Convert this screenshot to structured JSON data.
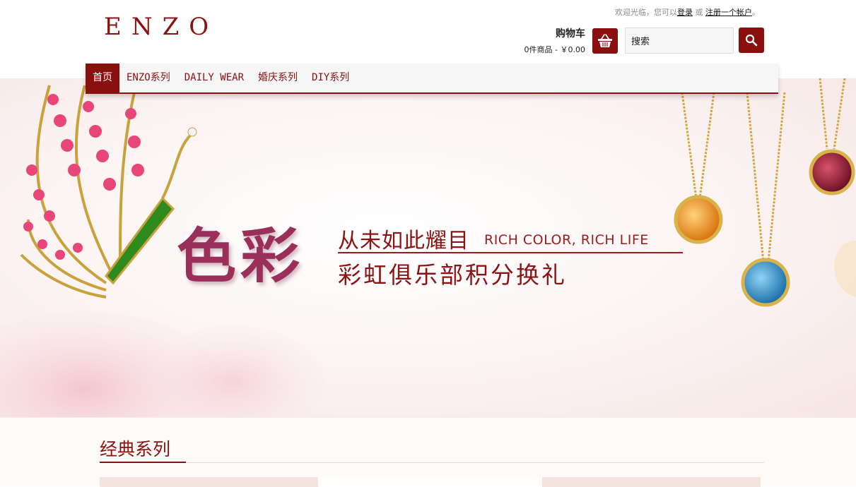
{
  "header": {
    "logo_text": "ENZO",
    "welcome_prefix": "欢迎光临，您可以",
    "login_label": "登录",
    "or_text": " 或 ",
    "register_label": "注册一个帐户",
    "welcome_suffix": "。"
  },
  "cart": {
    "title": "购物车",
    "summary": "0件商品 - ￥0.00",
    "icon": "shopping-basket-icon"
  },
  "search": {
    "value": "搜索",
    "icon": "search-icon"
  },
  "nav": {
    "items": [
      {
        "label": "首页"
      },
      {
        "label": "ENZO系列"
      },
      {
        "label": "DAILY WEAR"
      },
      {
        "label": "婚庆系列"
      },
      {
        "label": "DIY系列"
      }
    ]
  },
  "banner": {
    "big_title": "色彩",
    "headline_cn": "从未如此耀目",
    "headline_en": "RICH COLOR, RICH LIFE",
    "subline_cn": "彩虹俱乐部积分换礼"
  },
  "section": {
    "title": "经典系列"
  },
  "colors": {
    "brand": "#8a1010",
    "nav_bg": "#f6f6f6"
  }
}
